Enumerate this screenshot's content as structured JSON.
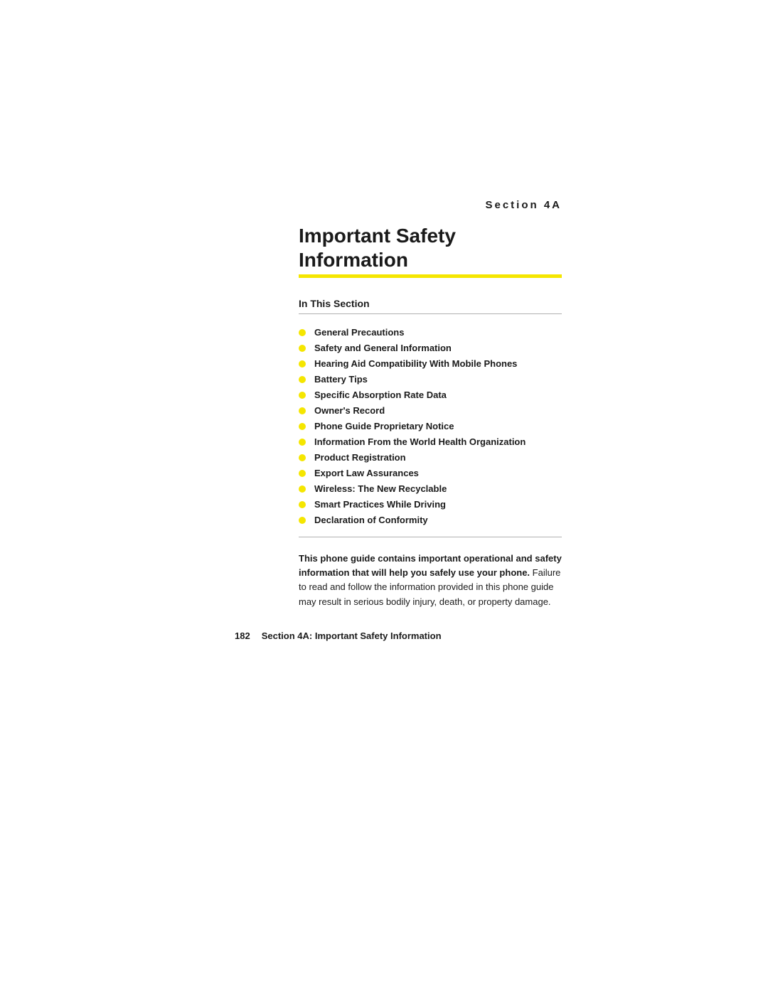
{
  "section_label": "Section 4A",
  "title": "Important Safety Information",
  "in_this_section": "In This Section",
  "toc_items": [
    "General Precautions",
    "Safety and General Information",
    "Hearing Aid Compatibility With Mobile Phones",
    "Battery Tips",
    "Specific Absorption Rate Data",
    "Owner's Record",
    "Phone Guide Proprietary Notice",
    "Information From the World Health Organization",
    "Product Registration",
    "Export Law Assurances",
    "Wireless: The New Recyclable",
    "Smart Practices While Driving",
    "Declaration of Conformity"
  ],
  "description_bold": "This phone guide contains important operational and safety information that will help you safely use your phone.",
  "description_regular": " Failure to read and follow the information provided in this phone guide may result in serious bodily injury, death, or property damage.",
  "footer_page_number": "182",
  "footer_text": "Section 4A: Important Safety Information",
  "colors": {
    "accent_yellow": "#f5e600",
    "text_dark": "#1a1a1a"
  }
}
